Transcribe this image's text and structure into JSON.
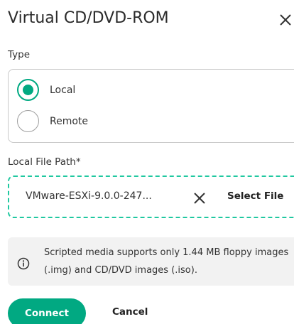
{
  "dialog": {
    "title": "Virtual CD/DVD-ROM",
    "close_icon": "close-icon"
  },
  "type_section": {
    "label": "Type",
    "options": [
      {
        "label": "Local",
        "selected": true
      },
      {
        "label": "Remote",
        "selected": false
      }
    ]
  },
  "file_path": {
    "label": "Local File Path*",
    "value": "VMware-ESXi-9.0.0-247...",
    "clear_icon": "close-icon",
    "select_label": "Select File"
  },
  "info": {
    "icon": "info-icon",
    "text": "Scripted media supports only 1.44 MB floppy images (.img) and CD/DVD images (.iso)."
  },
  "actions": {
    "connect_label": "Connect",
    "cancel_label": "Cancel"
  },
  "colors": {
    "accent": "#01a982",
    "focus_border": "#20c8a0",
    "info_background": "#f2f2f2"
  }
}
